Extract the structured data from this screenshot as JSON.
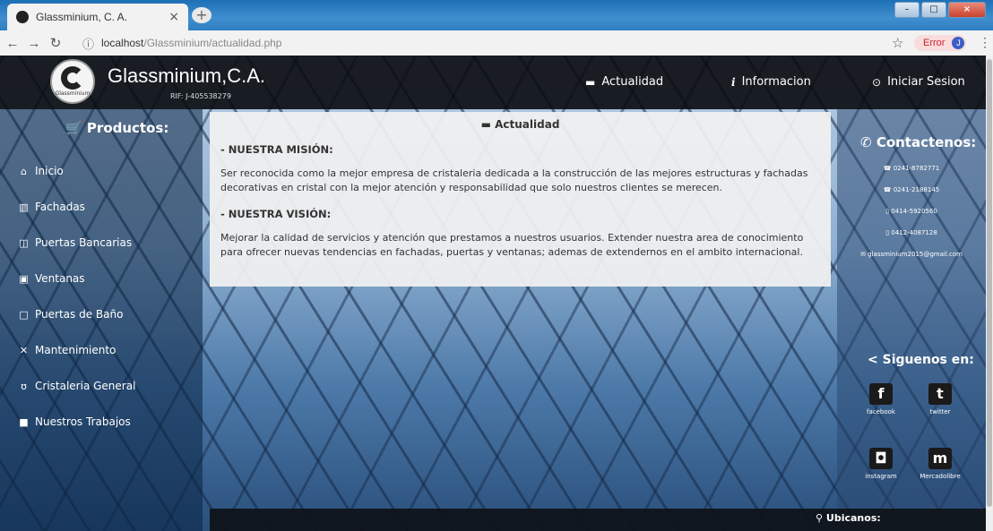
{
  "browser": {
    "tab_title": "Glassminium, C. A.",
    "tab_close": "×",
    "new_tab": "+",
    "url_host": "localhost",
    "url_path": "/Glassminium/actualidad.php",
    "error_label": "Error",
    "avatar_letter": "J"
  },
  "header": {
    "logo_text": "Glassminium",
    "brand": "Glassminium,C.A.",
    "rif": "RIF: J-405538279",
    "nav": {
      "actualidad": "Actualidad",
      "informacion": "Informacion",
      "iniciar": "Iniciar Sesion"
    }
  },
  "sidebar": {
    "title": "Productos:",
    "items": [
      {
        "label": "Inicio",
        "icon": "home-icon"
      },
      {
        "label": "Fachadas",
        "icon": "building-icon"
      },
      {
        "label": "Puertas Bancarias",
        "icon": "door-icon"
      },
      {
        "label": "Ventanas",
        "icon": "window-icon"
      },
      {
        "label": "Puertas de Baño",
        "icon": "square-icon"
      },
      {
        "label": "Mantenimiento",
        "icon": "tools-icon"
      },
      {
        "label": "Cristaleria General",
        "icon": "glasses-icon"
      },
      {
        "label": "Nuestros Trabajos",
        "icon": "briefcase-icon"
      }
    ]
  },
  "content": {
    "title": "Actualidad",
    "mision_head": "- NUESTRA MISIÓN:",
    "mision_text": "Ser reconocida como la mejor empresa de cristaleria dedicada a la construcción de las mejores estructuras y fachadas decorativas en cristal con la mejor atención y responsabilidad que solo nuestros clientes se merecen.",
    "vision_head": "- NUESTRA VISIÓN:",
    "vision_text": "Mejorar la calidad de servicios y atención que prestamos a nuestros usuarios. Extender nuestra area de conocimiento para ofrecer nuevas tendencias en fachadas, puertas y ventanas; ademas de extendernos en el ambito internacional."
  },
  "contact": {
    "title": "Contactenos:",
    "phone1": "0241-8782771",
    "phone2": "0241-2188145",
    "mobile1": "0414-5920560",
    "mobile2": "0412-4087128",
    "email": "glassminium2015@gmail.com"
  },
  "social": {
    "title": "Siguenos en:",
    "facebook": "facebook",
    "twitter": "twitter",
    "instagram": "instagram",
    "mercadolibre": "Mercadolibre"
  },
  "footer": {
    "ubicanos": "Ubicanos:"
  }
}
